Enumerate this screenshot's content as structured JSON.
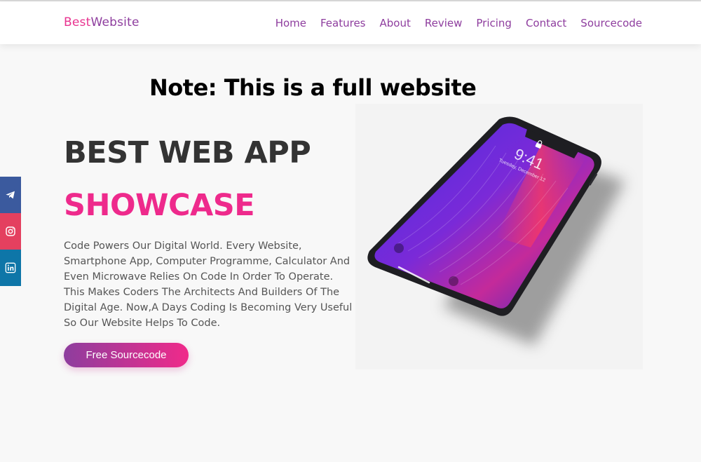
{
  "header": {
    "logo_part1": "Best",
    "logo_part2": "Website",
    "nav": [
      "Home",
      "Features",
      "About",
      "Review",
      "Pricing",
      "Contact",
      "Sourcecode"
    ]
  },
  "note": "Note: This is a full website",
  "hero": {
    "title_line1": "BEST WEB APP",
    "title_line2": "SHOWCASE",
    "description": "Code Powers Our Digital World. Every Website, Smartphone App, Computer Programme, Calculator And Even Microwave Relies On Code In Order To Operate. This Makes Coders The Architects And Builders Of The Digital Age. Now,A Days Coding Is Becoming Very Useful So Our Website Helps To Code.",
    "cta_label": "Free Sourcecode"
  },
  "phone": {
    "time": "9:41",
    "date": "Tuesday, December 12"
  },
  "social": [
    "telegram-icon",
    "instagram-icon",
    "linkedin-icon"
  ],
  "colors": {
    "brand_purple": "#8e3d9e",
    "brand_pink": "#ee2a8c",
    "telegram": "#3b5a9e",
    "instagram": "#e4405f",
    "linkedin": "#0e76a8"
  }
}
